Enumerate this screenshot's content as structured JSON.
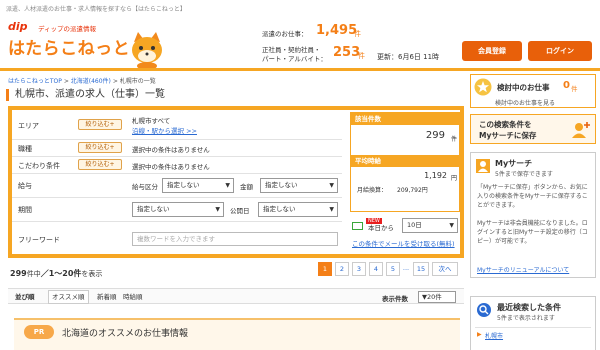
{
  "header": {
    "tagline": "派遣、人材派遣のお仕事・求人情報を探すなら【はたらこねっと】",
    "dip_logo": "dip",
    "dip_sub": "ディップの派遣情報",
    "brand": "はたらこねっと",
    "haken_label": "派遣のお仕事：",
    "haken_count": "1,495",
    "haken_unit": "件",
    "seishain_label_1": "正社員・契約社員・",
    "seishain_label_2": "パート・アルバイト：",
    "seishain_count": "253",
    "seishain_unit": "件",
    "updated": "更新：6月6日 11時",
    "register_button": "会員登録",
    "login_button": "ログイン"
  },
  "breadcrumb": {
    "top": "はたらこねっとTOP",
    "sep1": ">",
    "region": "北海道(460件)",
    "sep2": ">",
    "current": "札幌市の一覧"
  },
  "page_title": "札幌市、派遣の求人（仕事）一覧",
  "search": {
    "area_label": "エリア",
    "area_button": "絞り込む+",
    "area_value": "札幌市すべて",
    "area_link": "沿線・駅から選択 >>",
    "job_label": "職種",
    "job_button": "絞り込む+",
    "job_value": "選択中の条件はありません",
    "kodawari_label": "こだわり条件",
    "kodawari_button": "絞り込む+",
    "kodawari_value": "選択中の条件はありません",
    "salary_label": "給与",
    "salary_type_label": "給与区分",
    "salary_type_value": "指定しない",
    "amount_label": "金額",
    "amount_value": "指定しない",
    "period_label": "期間",
    "period_value": "指定しない",
    "published_label": "公開日",
    "published_value": "指定しない",
    "freeword_label": "フリーワード",
    "freeword_placeholder": "複数ワードを入力できます"
  },
  "results_panel": {
    "hit_label": "該当件数",
    "hit_count": "299",
    "hit_unit": "件",
    "avg_label": "平均時給",
    "avg_hourly": "1,192",
    "avg_hourly_unit": "円",
    "monthly_label": "月給換算：",
    "monthly_value": "209,792円",
    "mail_new": "NEW",
    "mail_prefix": "本日から",
    "mail_select": "10日",
    "mail_link": "この条件でメールを受け取る(無料)"
  },
  "listing": {
    "count_number": "299",
    "count_suffix": "件中",
    "range": "／1〜20件",
    "range_suffix": "を表示",
    "pages": [
      "1",
      "2",
      "3",
      "4",
      "5",
      "...",
      "15",
      "次へ"
    ],
    "sort_label": "並び順",
    "sort_recommended": "オススメ順",
    "sort_new": "新着順",
    "sort_hourly": "時給順",
    "display_label": "表示件数",
    "display_value": "20件"
  },
  "pr": {
    "badge": "PR",
    "title": "北海道のオススメのお仕事情報"
  },
  "sidebar": {
    "considering_label": "検討中のお仕事",
    "considering_count": "0",
    "considering_unit": "件",
    "considering_link": "検討中のお仕事を見る",
    "save_line1": "この検索条件を",
    "save_line2": "Myサーチに保存",
    "mysearch_title": "Myサーチ",
    "mysearch_sub": "5件まで保存できます",
    "mysearch_desc": "「Myサーチに保存」ボタンから、お気に入りの検索条件をMyサーチに保存することができます。",
    "mysearch_desc2": "Myサーチは非会員機能になりました。ログインすると旧Myサーチ設定の移行（コピー）が可能です。",
    "mysearch_link": "Myサーチのリニューアルについて",
    "recent_title": "最近検索した条件",
    "recent_sub": "5件まで表示されます",
    "recent_item": "札幌市"
  }
}
